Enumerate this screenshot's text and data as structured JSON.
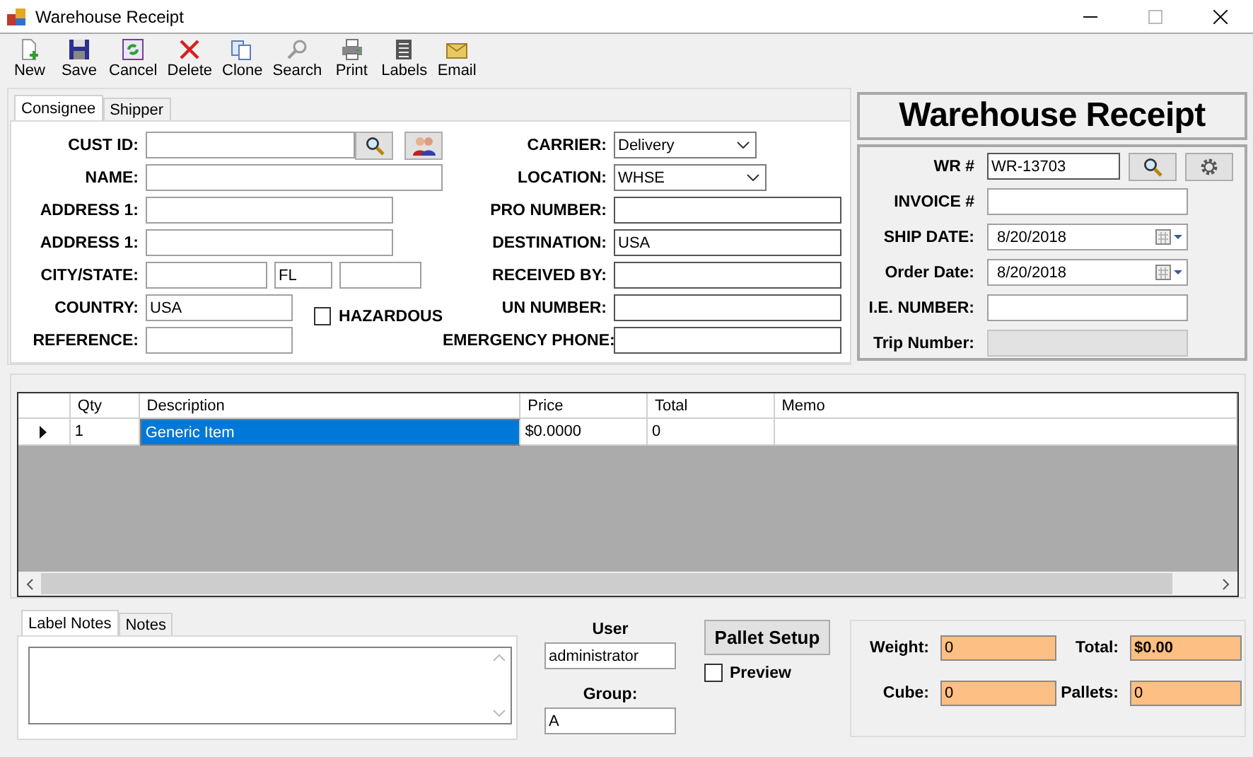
{
  "window": {
    "title": "Warehouse Receipt"
  },
  "toolbar": [
    {
      "label": "New"
    },
    {
      "label": "Save"
    },
    {
      "label": "Cancel"
    },
    {
      "label": "Delete"
    },
    {
      "label": "Clone"
    },
    {
      "label": "Search"
    },
    {
      "label": "Print"
    },
    {
      "label": "Labels"
    },
    {
      "label": "Email"
    }
  ],
  "party_tabs": [
    {
      "label": "Consignee",
      "selected": true
    },
    {
      "label": "Shipper",
      "selected": false
    }
  ],
  "consignee_fields": [
    {
      "kind": "lookup",
      "label": "CUST ID:"
    },
    {
      "kind": "wide",
      "label": "NAME:"
    },
    {
      "kind": "text",
      "label": "ADDRESS 1:"
    },
    {
      "kind": "text",
      "label": "ADDRESS 1:"
    },
    {
      "kind": "citystate",
      "label": "CITY/STATE:",
      "state": "FL"
    },
    {
      "kind": "short",
      "label": "COUNTRY:",
      "value": "USA"
    },
    {
      "kind": "short",
      "label": "REFERENCE:"
    }
  ],
  "hazardous": {
    "label": "HAZARDOUS",
    "checked": false
  },
  "shipping_fields": [
    {
      "kind": "select",
      "label": "CARRIER:",
      "value": "Delivery"
    },
    {
      "kind": "select",
      "label": "LOCATION:",
      "value": "WHSE"
    },
    {
      "kind": "text",
      "label": "PRO NUMBER:"
    },
    {
      "kind": "text",
      "label": "DESTINATION:",
      "value": "USA"
    },
    {
      "kind": "text",
      "label": "RECEIVED BY:"
    },
    {
      "kind": "text",
      "label": "UN NUMBER:"
    },
    {
      "kind": "text",
      "label": "EMERGENCY PHONE:"
    }
  ],
  "receipt": {
    "heading": "Warehouse Receipt",
    "fields": [
      {
        "kind": "lookup",
        "label": "WR #",
        "value": "WR-13703",
        "disabled": false
      },
      {
        "kind": "text",
        "label": "INVOICE #",
        "disabled": false
      },
      {
        "kind": "date",
        "label": "SHIP DATE:",
        "value": "8/20/2018",
        "disabled": false
      },
      {
        "kind": "date",
        "label": "Order Date:",
        "value": "8/20/2018",
        "disabled": false
      },
      {
        "kind": "text",
        "label": "I.E. NUMBER:",
        "disabled": false
      },
      {
        "kind": "text",
        "label": "Trip Number:",
        "disabled": true
      }
    ]
  },
  "items": {
    "columns": [
      "Qty",
      "Description",
      "Price",
      "Total",
      "Memo"
    ],
    "rows": [
      {
        "current": true,
        "cells": [
          {
            "value": "1",
            "selected": false
          },
          {
            "value": "Generic Item",
            "selected": true
          },
          {
            "value": "$0.0000",
            "selected": false
          },
          {
            "value": "0",
            "selected": false
          },
          {
            "selected": false
          }
        ]
      }
    ]
  },
  "notes_tabs": [
    {
      "label": "Label Notes",
      "selected": true
    },
    {
      "label": "Notes",
      "selected": false
    }
  ],
  "user": {
    "label": "User",
    "value": "administrator"
  },
  "group": {
    "label": "Group:",
    "value": "A"
  },
  "pallet_setup": {
    "label": "Pallet Setup"
  },
  "preview": {
    "label": "Preview",
    "checked": false
  },
  "totals": [
    {
      "kind": "number",
      "label": "Weight:",
      "value": "0"
    },
    {
      "kind": "amount",
      "label": "Total:",
      "value": "$0.00"
    },
    {
      "kind": "number",
      "label": "Cube:",
      "value": "0"
    },
    {
      "kind": "number",
      "label": "Pallets:",
      "value": "0"
    }
  ]
}
